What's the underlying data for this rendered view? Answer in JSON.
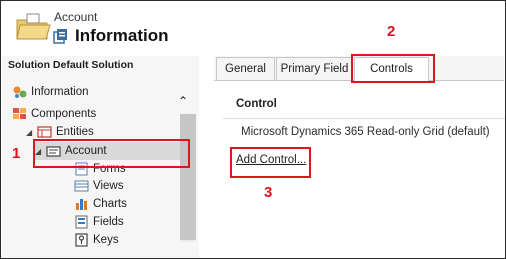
{
  "header": {
    "entity_label": "Account",
    "title": "Information"
  },
  "sidebar": {
    "heading": "Solution Default Solution",
    "items": [
      {
        "label": "Information"
      },
      {
        "label": "Components"
      },
      {
        "label": "Entities"
      },
      {
        "label": "Account"
      },
      {
        "label": "Forms"
      },
      {
        "label": "Views"
      },
      {
        "label": "Charts"
      },
      {
        "label": "Fields"
      },
      {
        "label": "Keys"
      }
    ]
  },
  "tabs": [
    {
      "label": "General"
    },
    {
      "label": "Primary Field"
    },
    {
      "label": "Controls"
    }
  ],
  "controls": {
    "column_header": "Control",
    "rows": [
      "Microsoft Dynamics 365 Read-only Grid (default)"
    ],
    "add_link": "Add Control..."
  },
  "callouts": [
    "1",
    "2",
    "3"
  ],
  "colors": {
    "callout": "#e0141e",
    "sidebar_bg": "#f6f6f6",
    "selected_bg": "#d9d9d9"
  }
}
